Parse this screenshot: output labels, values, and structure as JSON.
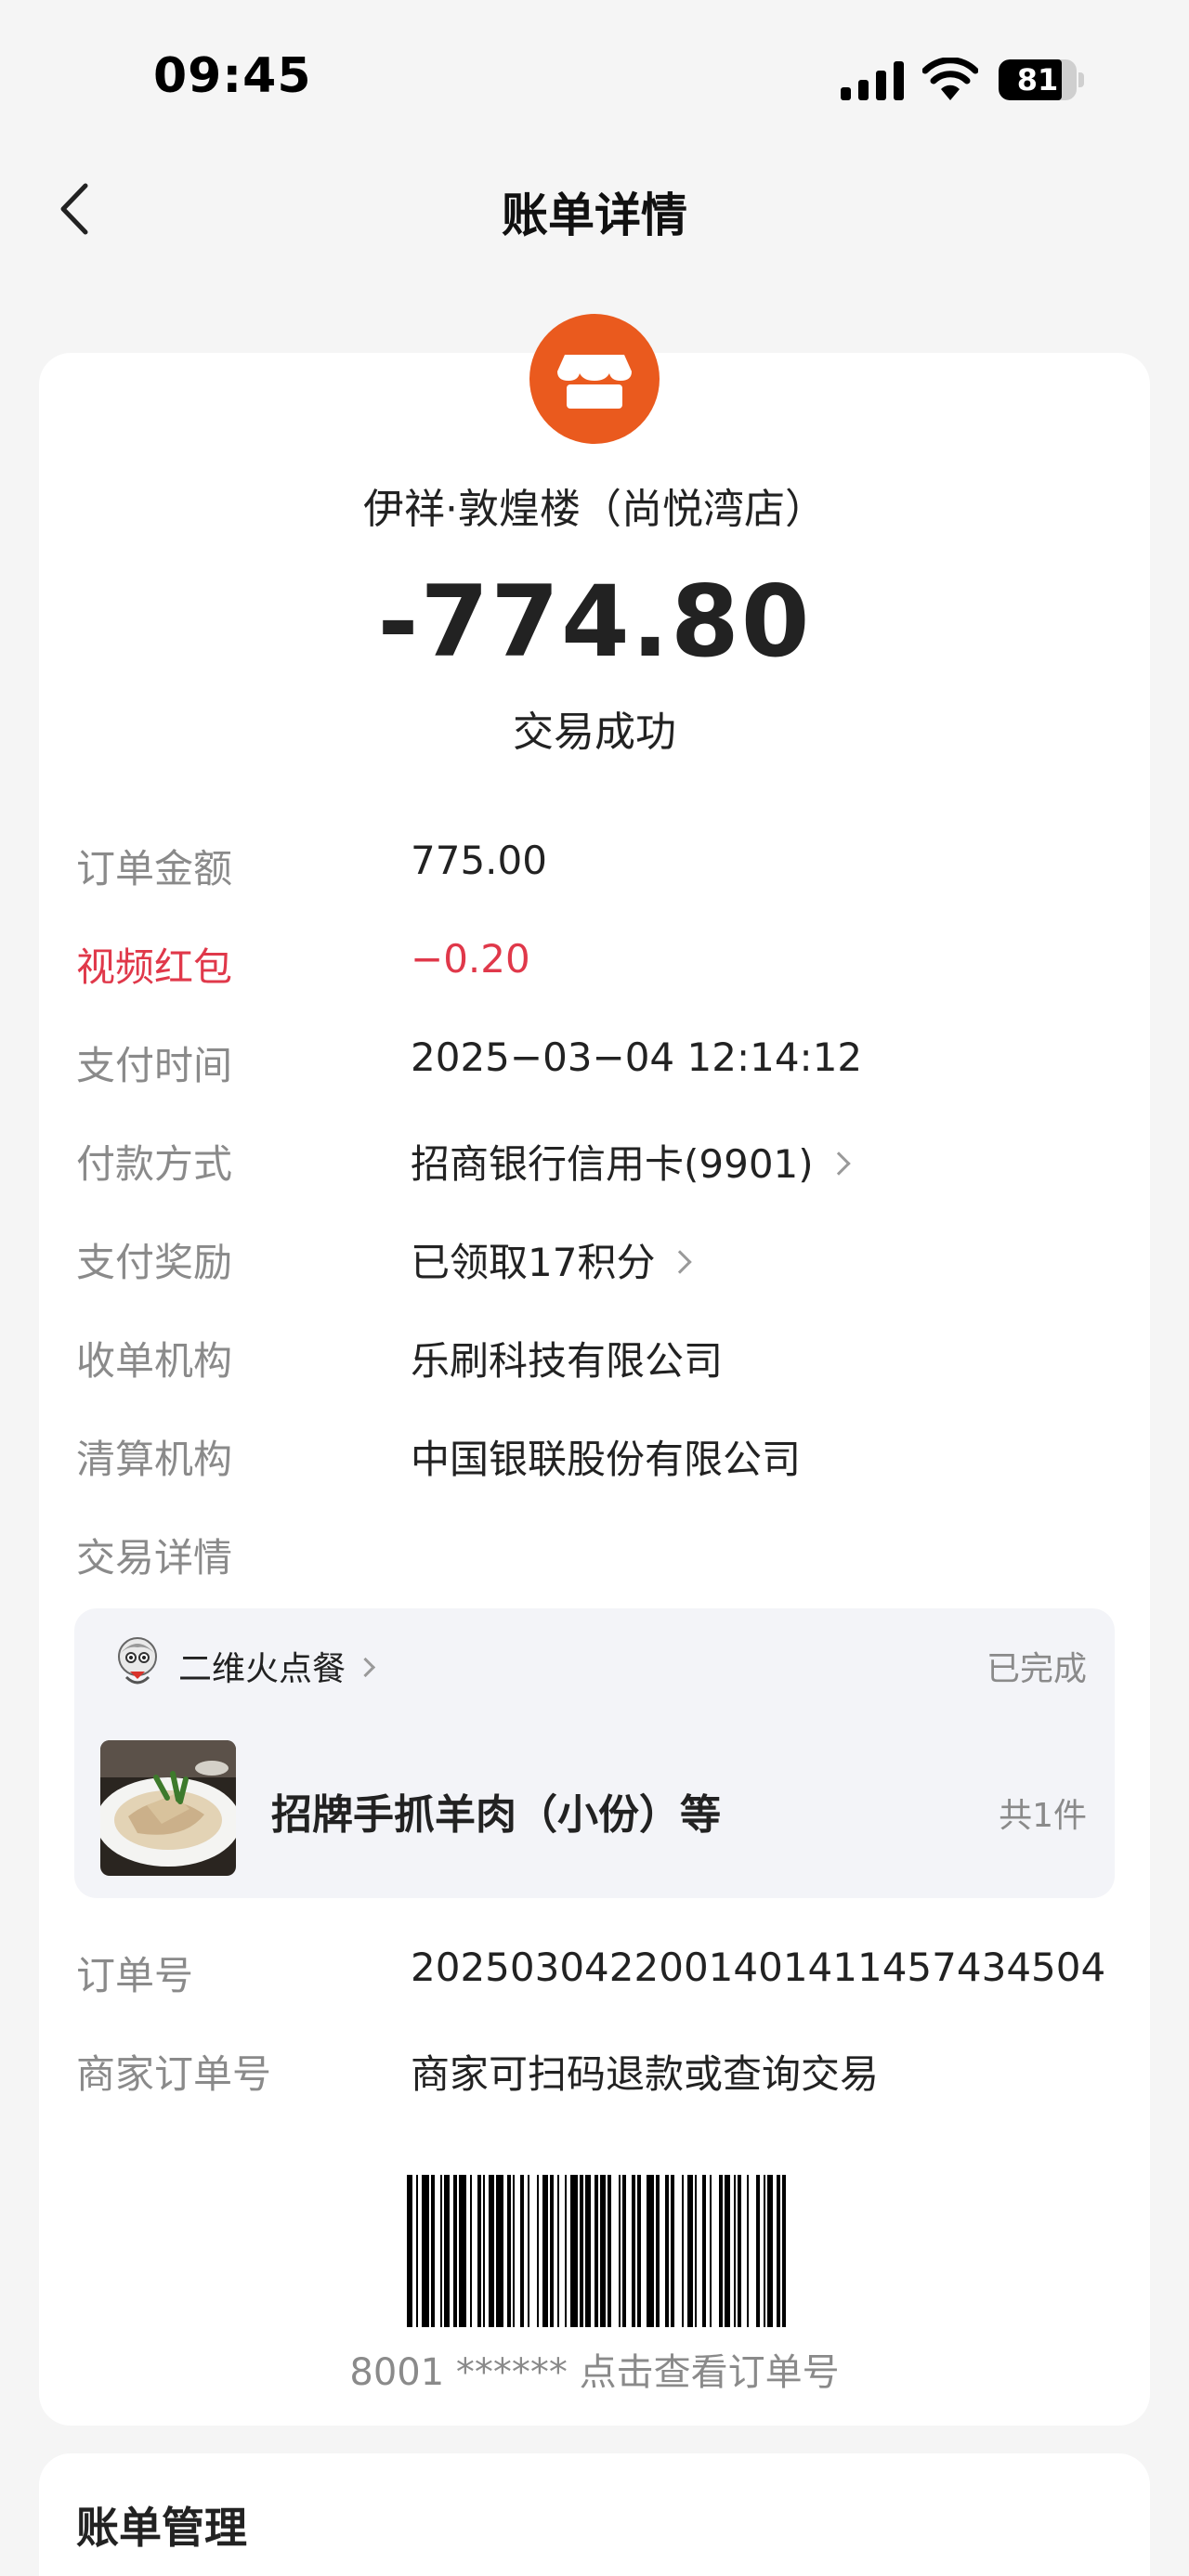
{
  "status_bar": {
    "time": "09:45",
    "battery_level": "81",
    "battery_fraction": 0.81
  },
  "nav": {
    "title": "账单详情",
    "back_icon": "chevron-left-icon"
  },
  "merchant": {
    "icon": "store-icon",
    "icon_color": "#ea5a1e",
    "name": "伊祥·敦煌楼（尚悦湾店）",
    "amount": "-774.80",
    "status": "交易成功"
  },
  "details": [
    {
      "label": "订单金额",
      "value": "775.00"
    },
    {
      "label": "视频红包",
      "value": "−0.20"
    },
    {
      "label": "支付时间",
      "value": "2025−03−04 12:14:12"
    },
    {
      "label": "付款方式",
      "value": "招商银行信用卡(9901)"
    },
    {
      "label": "支付奖励",
      "value": "已领取17积分"
    },
    {
      "label": "收单机构",
      "value": "乐刷科技有限公司"
    },
    {
      "label": "清算机构",
      "value": "中国银联股份有限公司"
    },
    {
      "label": "交易详情",
      "value": ""
    }
  ],
  "order": {
    "shop_name": "二维火点餐",
    "state": "已完成",
    "item_title": "招牌手抓羊肉（小份）等",
    "item_count": "共1件"
  },
  "order_info": [
    {
      "label": "订单号",
      "value": "2025030422001401411457434504"
    },
    {
      "label": "商家订单号",
      "value": "商家可扫码退款或查询交易"
    }
  ],
  "barcode": {
    "caption": "8001 ****** 点击查看订单号"
  },
  "manage": {
    "title": "账单管理"
  },
  "colors": {
    "accent": "#ea5a1e",
    "red": "#e0384a",
    "label_gray": "#8a8a8a"
  }
}
